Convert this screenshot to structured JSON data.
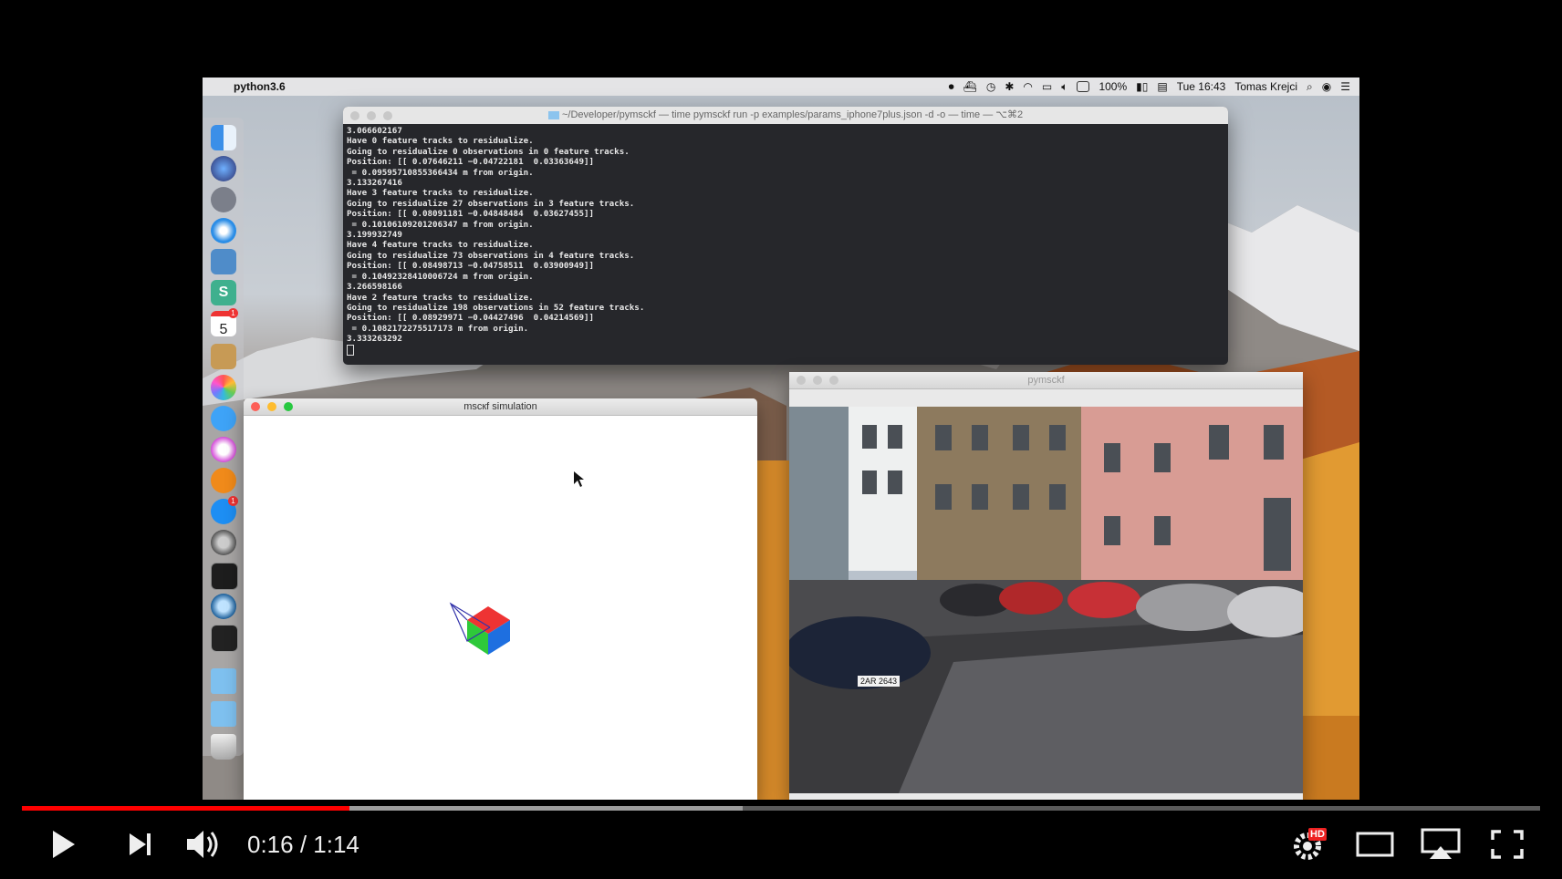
{
  "menubar": {
    "app_name": "python3.6",
    "battery": "100%",
    "clock": "Tue 16:43",
    "user": "Tomas Krejci"
  },
  "terminal": {
    "title": "~/Developer/pymsckf — time pymsckf run -p examples/params_iphone7plus.json -d  -o  — time — ⌥⌘2",
    "lines": [
      "3.066602167",
      "Have 0 feature tracks to residualize.",
      "Going to residualize 0 observations in 0 feature tracks.",
      "Position: [[ 0.07646211 −0.04722181  0.03363649]]",
      " = 0.09595710855366434 m from origin.",
      "3.133267416",
      "Have 3 feature tracks to residualize.",
      "Going to residualize 27 observations in 3 feature tracks.",
      "Position: [[ 0.08091181 −0.04848484  0.03627455]]",
      " = 0.10106109201206347 m from origin.",
      "3.199932749",
      "Have 4 feature tracks to residualize.",
      "Going to residualize 73 observations in 4 feature tracks.",
      "Position: [[ 0.08498713 −0.04758511  0.03900949]]",
      " = 0.10492328410006724 m from origin.",
      "3.266598166",
      "Have 2 feature tracks to residualize.",
      "Going to residualize 198 observations in 52 feature tracks.",
      "Position: [[ 0.08929971 −0.04427496  0.04214569]]",
      " = 0.1082172275517173 m from origin.",
      "3.333263292"
    ]
  },
  "sim_window": {
    "title": "mscкf simulation"
  },
  "camera_window": {
    "title": "pymsckf",
    "plate_text": "2AR 2643"
  },
  "dock": {
    "calendar_day": "5",
    "calendar_badge": "1",
    "appstore_badge": "1",
    "icons": [
      "finder-icon",
      "siri-icon",
      "launchpad-icon",
      "safari-icon",
      "preview-icon",
      "slack-icon",
      "calendar-icon",
      "notes-icon",
      "photos-icon",
      "messages-icon",
      "itunes-icon",
      "ibooks-icon",
      "app-store-icon",
      "system-preferences-icon",
      "terminal-icon",
      "quicktime-icon",
      "console-icon",
      "folder-icon",
      "downloads-folder-icon",
      "trash-icon"
    ]
  },
  "player": {
    "current_time": "0:16",
    "separator": " / ",
    "duration": "1:14",
    "time_display": "0:16 / 1:14",
    "progress_played": 0.216,
    "progress_buffered": 0.475,
    "quality_badge": "HD",
    "accent_color": "#ff0000"
  }
}
